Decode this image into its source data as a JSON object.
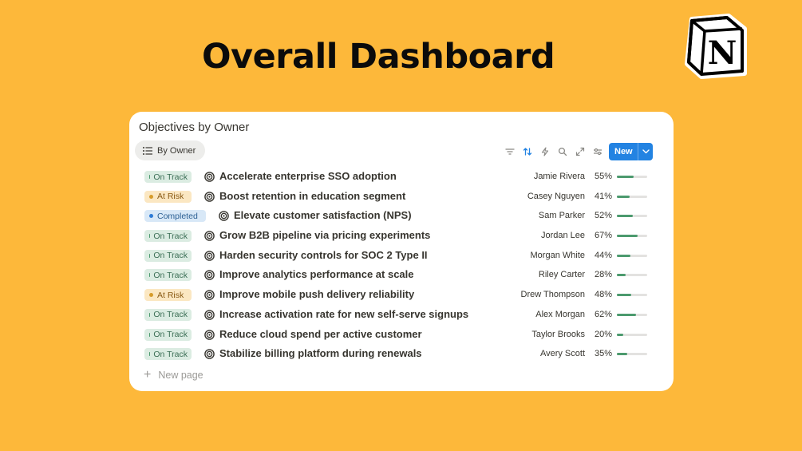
{
  "page": {
    "title": "Overall Dashboard",
    "logo_letter": "N"
  },
  "card": {
    "title": "Objectives by Owner",
    "view_label": "By Owner",
    "new_button_label": "New",
    "new_page_label": "New page",
    "toolbar_icons": [
      "filter-icon",
      "sort-icon",
      "automation-icon",
      "search-icon",
      "expand-icon",
      "settings-icon"
    ]
  },
  "objectives": [
    {
      "status": "On Track",
      "status_key": "ontrack",
      "name": "Accelerate enterprise SSO adoption",
      "owner": "Jamie Rivera",
      "progress_label": "55%",
      "progress": 0.55
    },
    {
      "status": "At Risk",
      "status_key": "atrisk",
      "name": "Boost retention in education segment",
      "owner": "Casey Nguyen",
      "progress_label": "41%",
      "progress": 0.41
    },
    {
      "status": "Completed",
      "status_key": "completed",
      "name": "Elevate customer satisfaction (NPS)",
      "owner": "Sam Parker",
      "progress_label": "52%",
      "progress": 0.52
    },
    {
      "status": "On Track",
      "status_key": "ontrack",
      "name": "Grow B2B pipeline via pricing experiments",
      "owner": "Jordan Lee",
      "progress_label": "67%",
      "progress": 0.67
    },
    {
      "status": "On Track",
      "status_key": "ontrack",
      "name": "Harden security controls for SOC 2 Type II",
      "owner": "Morgan White",
      "progress_label": "44%",
      "progress": 0.44
    },
    {
      "status": "On Track",
      "status_key": "ontrack",
      "name": "Improve analytics performance at scale",
      "owner": "Riley Carter",
      "progress_label": "28%",
      "progress": 0.28
    },
    {
      "status": "At Risk",
      "status_key": "atrisk",
      "name": "Improve mobile push delivery reliability",
      "owner": "Drew Thompson",
      "progress_label": "48%",
      "progress": 0.48
    },
    {
      "status": "On Track",
      "status_key": "ontrack",
      "name": "Increase activation rate for new self-serve signups",
      "owner": "Alex Morgan",
      "progress_label": "62%",
      "progress": 0.62
    },
    {
      "status": "On Track",
      "status_key": "ontrack",
      "name": "Reduce cloud spend per active customer",
      "owner": "Taylor Brooks",
      "progress_label": "20%",
      "progress": 0.2
    },
    {
      "status": "On Track",
      "status_key": "ontrack",
      "name": "Stabilize billing platform during renewals",
      "owner": "Avery Scott",
      "progress_label": "35%",
      "progress": 0.35
    }
  ],
  "colors": {
    "background": "#FDB83A",
    "accent": "#2383e2",
    "on_track": "#4c9a6e",
    "at_risk": "#d69b2a",
    "completed": "#2e7bd6"
  }
}
